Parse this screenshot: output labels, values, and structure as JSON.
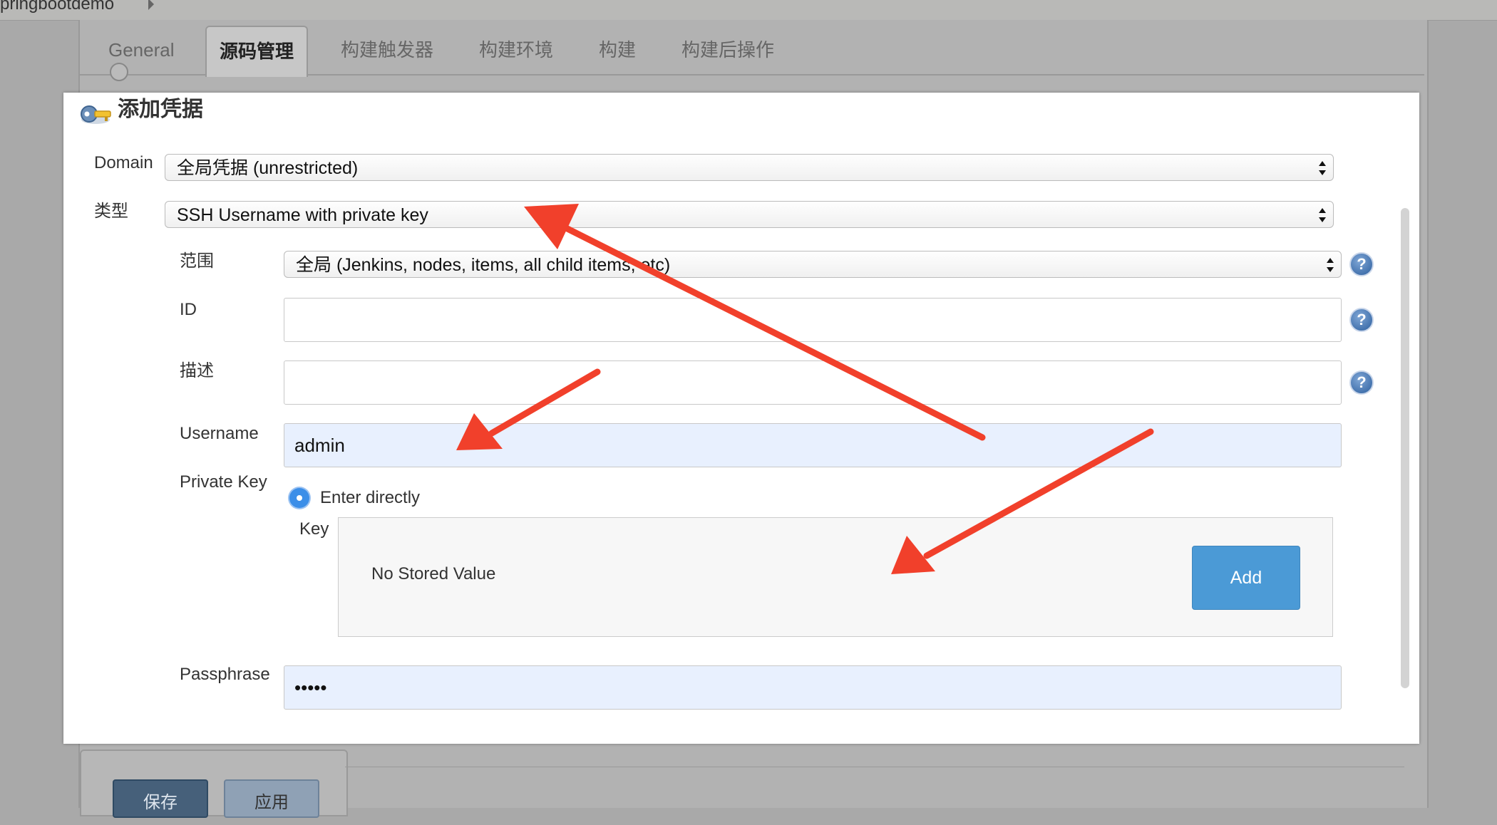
{
  "breadcrumb": {
    "project": "pringbootdemo"
  },
  "tabs": [
    {
      "label": "General"
    },
    {
      "label": "源码管理"
    },
    {
      "label": "构建触发器"
    },
    {
      "label": "构建环境"
    },
    {
      "label": "构建"
    },
    {
      "label": "构建后操作"
    }
  ],
  "dialog": {
    "title": "添加凭据",
    "domain": {
      "label": "Domain",
      "value": "全局凭据 (unrestricted)"
    },
    "kind": {
      "label": "类型",
      "value": "SSH Username with private key"
    },
    "scope": {
      "label": "范围",
      "value": "全局 (Jenkins, nodes, items, all child items, etc)"
    },
    "id": {
      "label": "ID",
      "value": ""
    },
    "description": {
      "label": "描述",
      "value": ""
    },
    "username": {
      "label": "Username",
      "value": "admin"
    },
    "private_key": {
      "label": "Private Key",
      "option": "Enter directly",
      "key_label": "Key",
      "stored_value": "No Stored Value",
      "add_label": "Add"
    },
    "passphrase": {
      "label": "Passphrase",
      "value": "•••••"
    },
    "help_glyph": "?"
  },
  "footer": {
    "save_label": "保存",
    "apply_label": "应用"
  },
  "colors": {
    "accent": "#4b9ad6",
    "annotation_arrow": "#f1402b",
    "autofill": "#e8f0fe"
  }
}
